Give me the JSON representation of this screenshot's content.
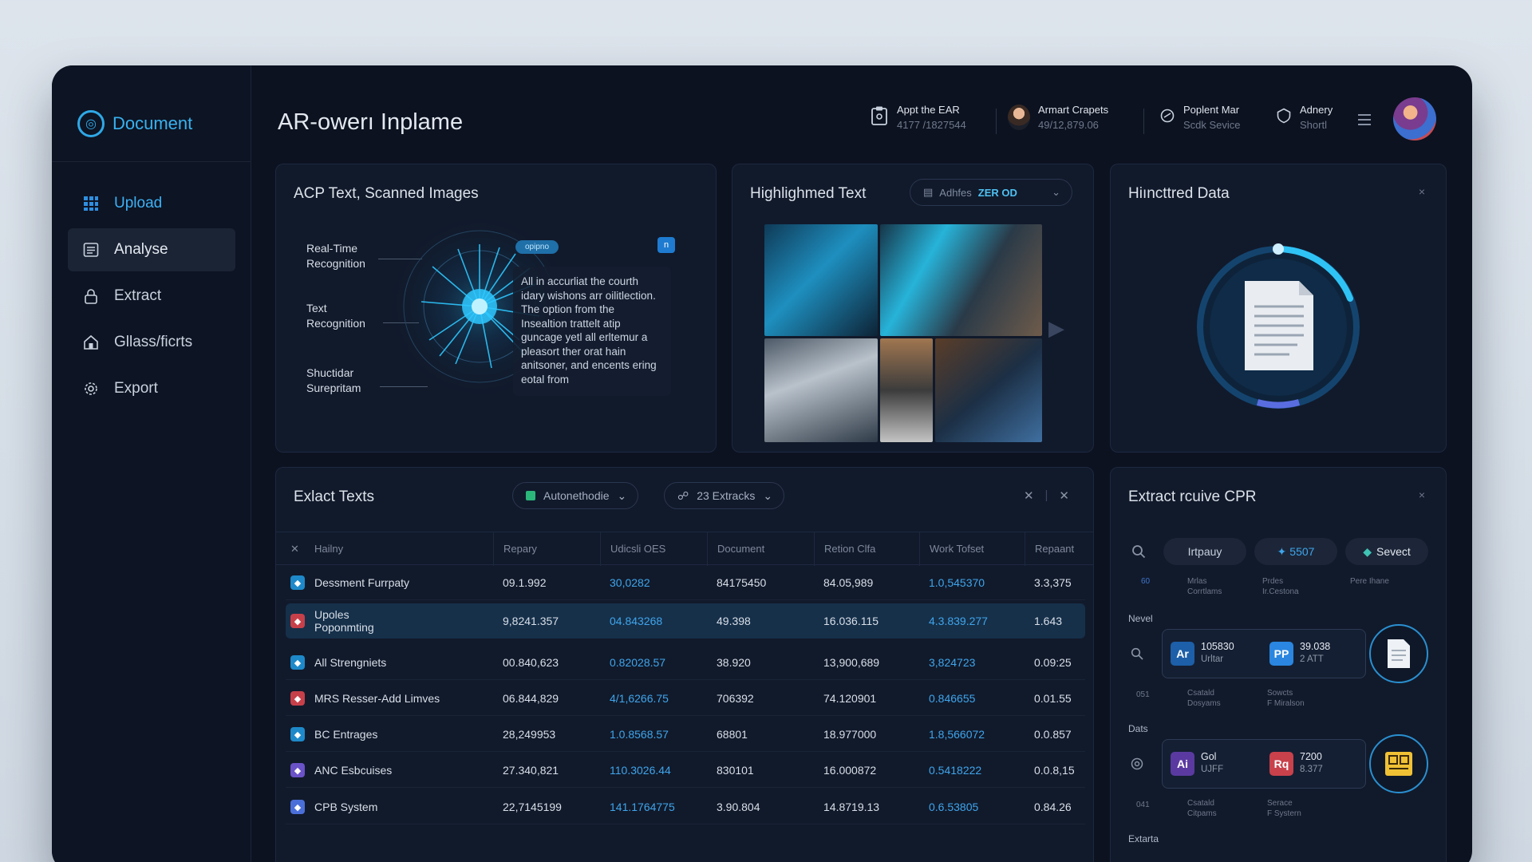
{
  "brand": {
    "name": "Document"
  },
  "sidebar": {
    "items": [
      {
        "label": "Upload",
        "icon": "upload-icon"
      },
      {
        "label": "Analyse",
        "icon": "analyse-icon"
      },
      {
        "label": "Extract",
        "icon": "lock-icon"
      },
      {
        "label": "Gllass/ficrts",
        "icon": "home-icon"
      },
      {
        "label": "Export",
        "icon": "gear-icon"
      }
    ]
  },
  "header": {
    "title": "AR-owerı Inplame",
    "items": [
      {
        "label": "Appt the EAR",
        "value": "4177 /1827544"
      },
      {
        "label": "Armart Crapets",
        "value": "49/12,879.06"
      },
      {
        "label": "Poplent Mar",
        "value": "Scdk Sevice"
      },
      {
        "label": "Adnery",
        "value": "Shortl"
      }
    ]
  },
  "ocr_card": {
    "title": "ACP Text, Scanned Images",
    "labels": [
      "Real-Time\nRecognition",
      "Text\nRecognition",
      "Shuctidar\nSurepritam"
    ],
    "tag": "opipno",
    "badge": "n",
    "text": "All in accurliat the courth idary wishons arr oilitlection. The option from the Insealtion trattelt atip guncage yetl all erltemur a pleasort ther orat hain anitsoner, and encents ering eotal from"
  },
  "highlight_card": {
    "title": "Highlighmed Text",
    "select_prefix": "Adhfes",
    "select_value": "ZER OD"
  },
  "data_card": {
    "title": "Hiıncttred Data",
    "close": "×"
  },
  "table_card": {
    "title": "Exlact Texts",
    "filter1": "Autonethodie",
    "filter2": "23  Extracks",
    "columns": [
      "Hailny",
      "Repary",
      "Udicsli OES",
      "Document",
      "Retion Clfa",
      "Work Tofset",
      "Repaant"
    ],
    "rows": [
      {
        "icon_color": "#1e89c9",
        "name": "Dessment Furrpaty",
        "c1": "09.1.992",
        "c2": "30,0282",
        "c3": "84175450",
        "c4": "84.05,989",
        "c5": "1.0,545370",
        "c6": "3.3,375",
        "selected": false
      },
      {
        "icon_color": "#c6404a",
        "name": "Upoles\nPoponmting",
        "c1": "9,8241.357",
        "c2": "04.843268",
        "c3": "49.398",
        "c4": "16.036.115",
        "c5": "4.3.839.277",
        "c6": "1.643",
        "selected": true
      },
      {
        "icon_color": "#1e89c9",
        "name": "All Strengniets",
        "c1": "00.840,623",
        "c2": "0.82028.57",
        "c3": "38.920",
        "c4": "13,900,689",
        "c5": "3,824723",
        "c6": "0.09:25",
        "selected": false
      },
      {
        "icon_color": "#c6404a",
        "name": "MRS Resser-Add Limves",
        "c1": "06.844,829",
        "c2": "4/1,6266.75",
        "c3": "706392",
        "c4": "74.120901",
        "c5": "0.846655",
        "c6": "0.01.55",
        "selected": false
      },
      {
        "icon_color": "#1e89c9",
        "name": "BC Entrages",
        "c1": "28,249953",
        "c2": "1.0.8568.57",
        "c3": "68801",
        "c4": "18.977000",
        "c5": "1.8,566072",
        "c6": "0.0.857",
        "selected": false
      },
      {
        "icon_color": "#6a52c8",
        "name": "ANC Esbcuises",
        "c1": "27.340,821",
        "c2": "110.3026.44",
        "c3": "830101",
        "c4": "16.000872",
        "c5": "0.5418222",
        "c6": "0.0.8,15",
        "selected": false
      },
      {
        "icon_color": "#4b6fd8",
        "name": "CPB System",
        "c1": "22,7145199",
        "c2": "141.1764775",
        "c3": "3.90.804",
        "c4": "14.8719.13",
        "c5": "0.6.53805",
        "c6": "0.84.26",
        "selected": false
      }
    ]
  },
  "extract_card": {
    "title": "Extract rcuive CPR",
    "chips": [
      "Irtpauy",
      "5507",
      "Sevect"
    ],
    "mini_labels": {
      "a": "60",
      "b": "Mrlas\nCorrtlams",
      "c": "Prdes\nIr.Cestona",
      "d": "Pere Ihane"
    },
    "sections": [
      "Nevel",
      "Dats",
      "Extarta"
    ],
    "strip1": {
      "t1": "105830",
      "s1": "Urltar",
      "t2": "39.038",
      "s2": "2 ATT",
      "num": "051",
      "f1": "Csatald\nDosyams",
      "f2": "Sowcts\nF Miralson"
    },
    "strip2": {
      "t1": "Gol",
      "s1": "UJFF",
      "t2": "7200",
      "s2": "8.377",
      "num": "041",
      "f1": "Csatald\nCitpams",
      "f2": "Serace\nF Systern"
    }
  },
  "colors": {
    "accent": "#38b2f0",
    "bg": "#0c1220",
    "card": "#111a2b"
  }
}
